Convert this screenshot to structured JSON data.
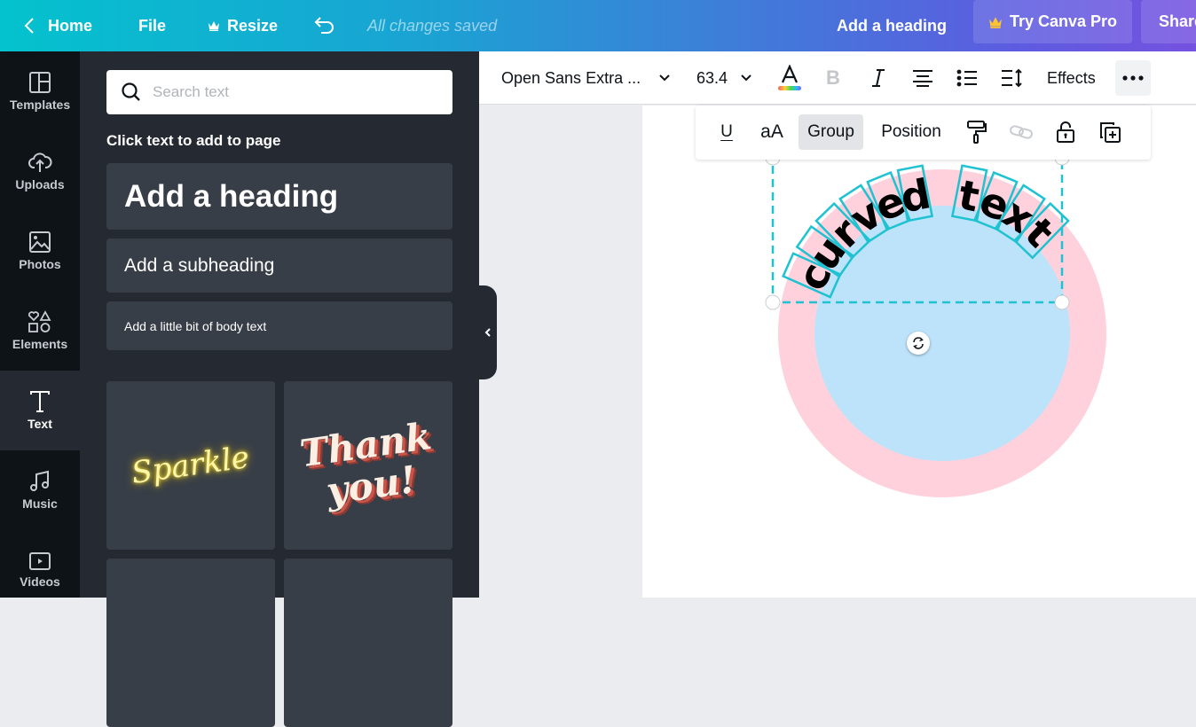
{
  "topbar": {
    "home_label": "Home",
    "file_label": "File",
    "resize_label": "Resize",
    "save_status": "All changes saved",
    "doc_title": "Add a heading",
    "pro_label": "Try Canva Pro",
    "share_label": "Share"
  },
  "rail": {
    "items": [
      {
        "label": "Templates",
        "icon": "templates-icon"
      },
      {
        "label": "Uploads",
        "icon": "upload-cloud-icon"
      },
      {
        "label": "Photos",
        "icon": "photo-icon"
      },
      {
        "label": "Elements",
        "icon": "shapes-icon"
      },
      {
        "label": "Text",
        "icon": "text-icon",
        "active": true
      },
      {
        "label": "Music",
        "icon": "music-note-icon"
      },
      {
        "label": "Videos",
        "icon": "video-icon"
      }
    ]
  },
  "panel": {
    "search_placeholder": "Search text",
    "search_value": "",
    "hint": "Click text to add to page",
    "heading_card": "Add a heading",
    "subheading_card": "Add a subheading",
    "body_card": "Add a little bit of body text",
    "tiles": [
      {
        "text": "Sparkle",
        "style": "neon-yellow"
      },
      {
        "line1": "Thank",
        "line2": "you!",
        "style": "retro-shadow"
      }
    ]
  },
  "toolbar": {
    "font_family": "Open Sans Extra ...",
    "font_size": "63.4",
    "text_color_gradient": [
      "#ff5a5a",
      "#ffd23f",
      "#3fd94b",
      "#2fb8ff",
      "#7a5cff"
    ],
    "bold_disabled": true,
    "effects_label": "Effects"
  },
  "floating_toolbar": {
    "underline_label": "U",
    "case_label": "aA",
    "group_label": "Group",
    "position_label": "Position"
  },
  "canvas": {
    "curved_text": "curved text",
    "colors": {
      "outer_ring": "#ffd1dc",
      "inner_circle": "#bde3fa",
      "selection": "#1ec2d1",
      "text": "#000000"
    }
  }
}
